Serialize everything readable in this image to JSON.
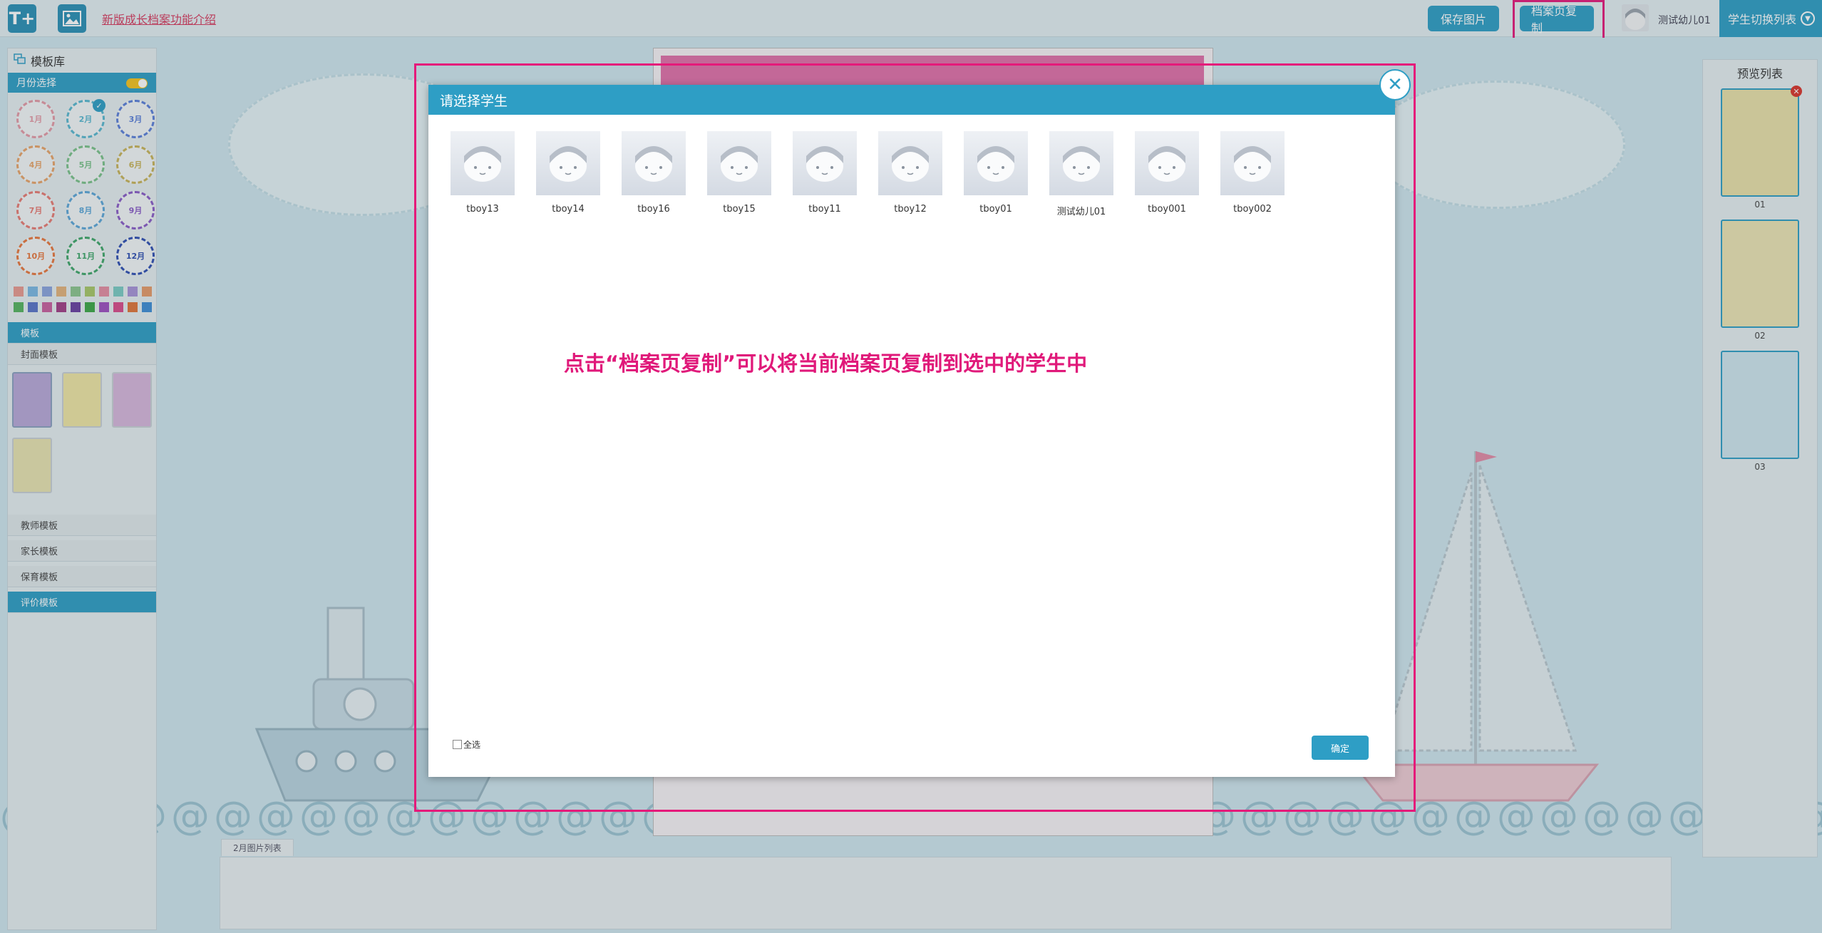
{
  "topbar": {
    "text_tool_icon": "text-add-icon",
    "image_tool_icon": "image-icon",
    "intro_link": "新版成长档案功能介绍",
    "save_image": "保存图片",
    "copy_page": "档案页复制",
    "current_user": "测试幼儿01",
    "student_switch": "学生切换列表"
  },
  "left_panel": {
    "title": "模板库",
    "month_select": "月份选择",
    "months": [
      "1月",
      "2月",
      "3月",
      "4月",
      "5月",
      "6月",
      "7月",
      "8月",
      "9月",
      "10月",
      "11月",
      "12月"
    ],
    "month_colors": [
      "#e49aa6",
      "#58b7d0",
      "#5b7fd9",
      "#e8a469",
      "#7ac28a",
      "#c9b45a",
      "#e87b73",
      "#5ca7d8",
      "#8a5cc7",
      "#e8773e",
      "#3fa66a",
      "#2f4fb3"
    ],
    "swatch_colors": [
      "#e8998f",
      "#7bb8e3",
      "#8aa4dd",
      "#e3b37c",
      "#8bc58e",
      "#a8c768",
      "#e58da3",
      "#7acbc4",
      "#a893d8",
      "#e69a6a",
      "#55b35e",
      "#5a73c9",
      "#c85f9e",
      "#a23e85",
      "#6a3fa0",
      "#3ba646",
      "#9e4fc0",
      "#d94b8a",
      "#e0743a",
      "#3d8dd6"
    ],
    "templates_header": "模板",
    "cover_templates": "封面模板",
    "teacher_templates": "教师模板",
    "parent_templates": "家长模板",
    "care_templates": "保育模板",
    "eval_templates": "评价模板"
  },
  "right_panel": {
    "title": "预览列表",
    "pages": [
      "01",
      "02",
      "03"
    ]
  },
  "bottom_panel": {
    "tab": "2月图片列表"
  },
  "modal": {
    "title": "请选择学生",
    "students": [
      "tboy13",
      "tboy14",
      "tboy16",
      "tboy15",
      "tboy11",
      "tboy12",
      "tboy01",
      "测试幼儿01",
      "tboy001",
      "tboy002"
    ],
    "annotation": "点击“档案页复制”可以将当前档案页复制到选中的学生中",
    "select_all": "全选",
    "confirm": "确定"
  }
}
